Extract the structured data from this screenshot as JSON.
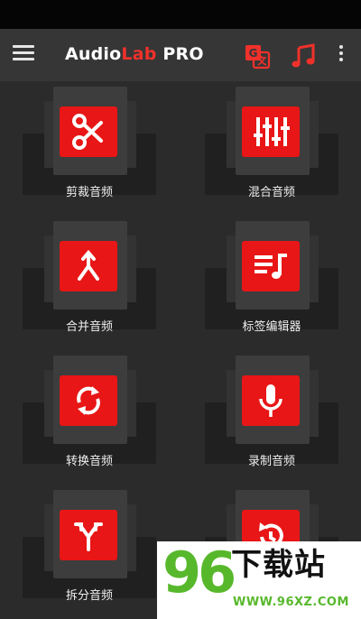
{
  "app": {
    "title_part1": "Audio",
    "title_part2": "Lab",
    "title_part3": " PRO"
  },
  "icons": {
    "menu": "hamburger-icon",
    "translate": "translate-icon",
    "music": "music-note-icon",
    "more": "more-vertical-icon"
  },
  "colors": {
    "accent": "#e81616",
    "background": "#2b2b2b",
    "appbar": "#363636"
  },
  "tools": [
    {
      "label": "剪裁音频",
      "icon": "scissors-icon"
    },
    {
      "label": "混合音频",
      "icon": "equalizer-icon"
    },
    {
      "label": "合并音频",
      "icon": "merge-icon"
    },
    {
      "label": "标签编辑器",
      "icon": "playlist-music-icon"
    },
    {
      "label": "转换音频",
      "icon": "convert-icon"
    },
    {
      "label": "录制音频",
      "icon": "microphone-icon"
    },
    {
      "label": "拆分音频",
      "icon": "split-icon"
    },
    {
      "label": "",
      "icon": "restore-icon"
    }
  ],
  "watermark": {
    "number": "96",
    "text": "下载站",
    "url": "WWW.96XZ.COM"
  }
}
